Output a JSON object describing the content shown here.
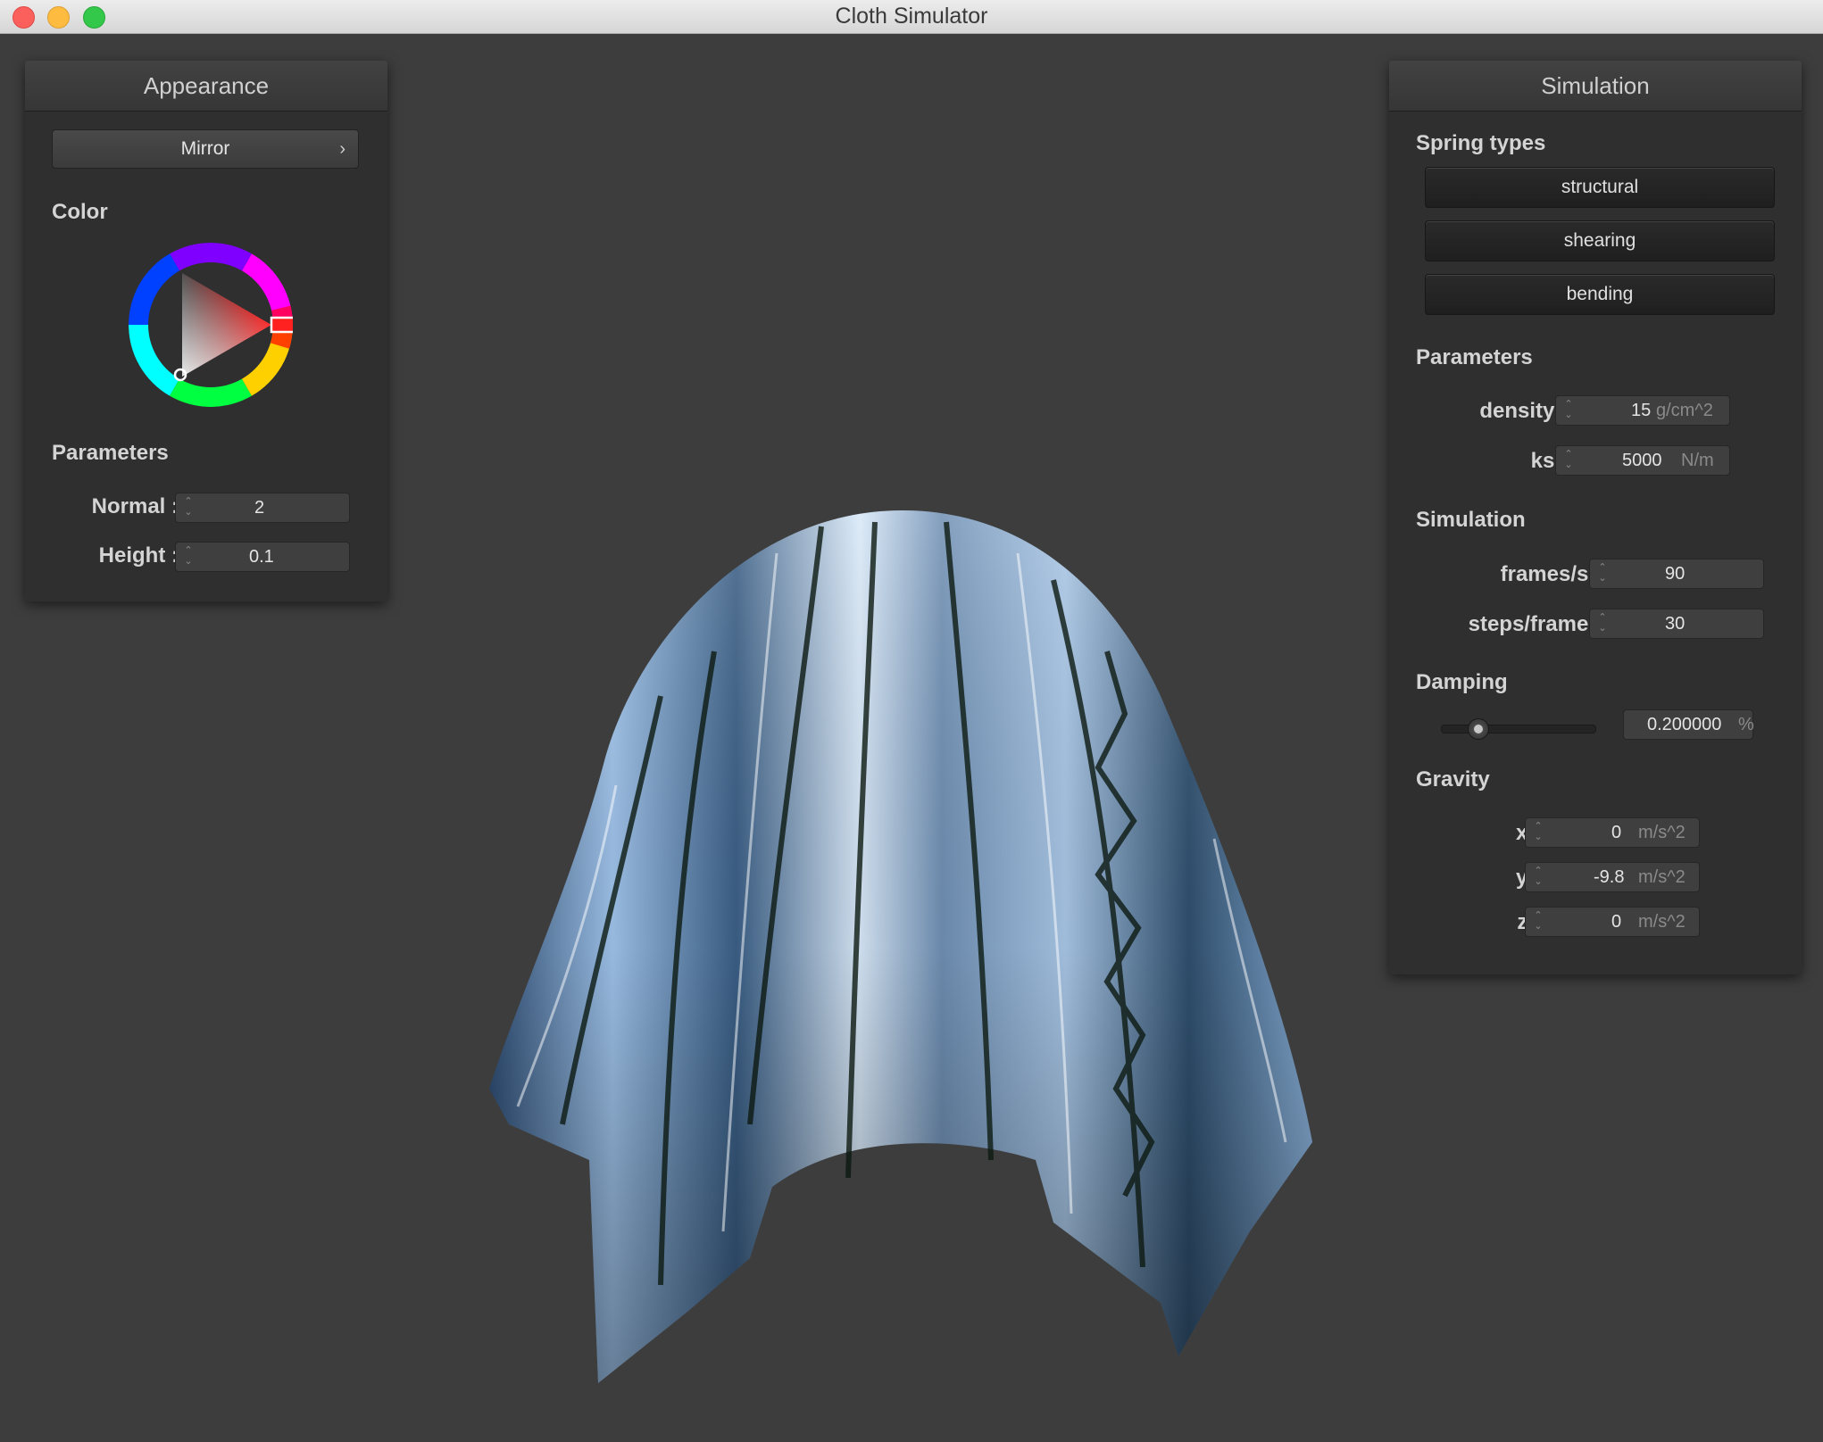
{
  "window": {
    "title": "Cloth Simulator"
  },
  "appearance": {
    "title": "Appearance",
    "shader_select": "Mirror",
    "color_label": "Color",
    "parameters_label": "Parameters",
    "normal_label": "Normal :",
    "normal_value": "2",
    "height_label": "Height :",
    "height_value": "0.1",
    "selected_color": "#ff0000"
  },
  "simulation": {
    "title": "Simulation",
    "spring_types_label": "Spring types",
    "spring_types": [
      "structural",
      "shearing",
      "bending"
    ],
    "parameters_label": "Parameters",
    "density_label": "density :",
    "density_value": "15",
    "density_unit": "g/cm^2",
    "ks_label": "ks :",
    "ks_value": "5000",
    "ks_unit": "N/m",
    "simulation_label": "Simulation",
    "fps_label": "frames/s :",
    "fps_value": "90",
    "steps_label": "steps/frame :",
    "steps_value": "30",
    "damping_label": "Damping",
    "damping_value": "0.200000",
    "damping_unit": "%",
    "damping_slider_fraction": 0.2,
    "gravity_label": "Gravity",
    "gx_label": "x :",
    "gx_value": "0",
    "gy_label": "y :",
    "gy_value": "-9.8",
    "gz_label": "z :",
    "gz_value": "0",
    "gravity_unit": "m/s^2"
  }
}
